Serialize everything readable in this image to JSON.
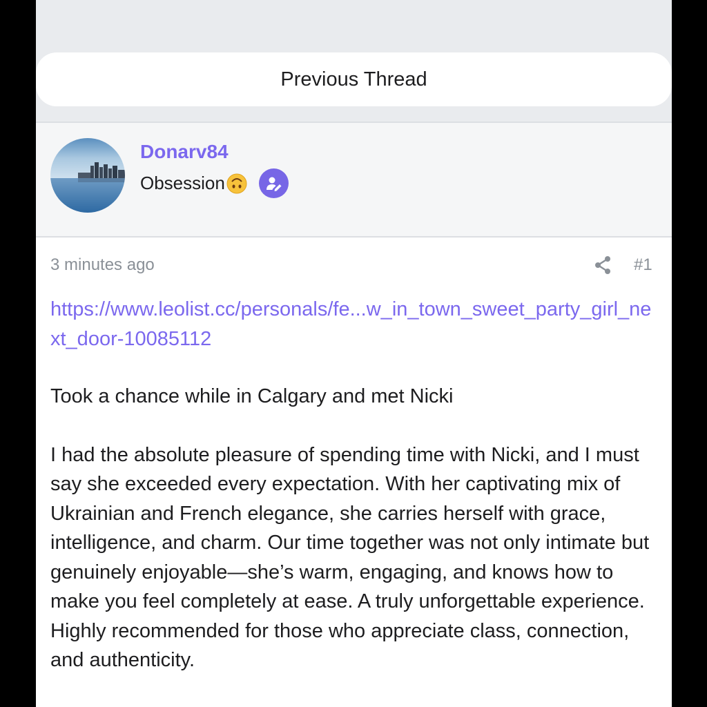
{
  "nav": {
    "previous_thread_label": "Previous Thread"
  },
  "author": {
    "username": "Donarv84",
    "title": "Obsession",
    "title_emoji_icon": "upside-down-face-emoji",
    "badge_icon": "user-edit-icon"
  },
  "post": {
    "timestamp": "3 minutes ago",
    "share_icon": "share-icon",
    "number": "#1",
    "link": "https://www.leolist.cc/personals/fe...w_in_town_sweet_party_girl_next_door-10085112",
    "paragraphs": [
      "Took a chance while in Calgary and met Nicki",
      "I had the absolute pleasure of spending time with Nicki, and I must say she exceeded every expectation. With her captivating mix of Ukrainian and French elegance, she carries herself with grace, intelligence, and charm. Our time together was not only intimate but genuinely enjoyable—she’s warm, engaging, and knows how to make you feel completely at ease. A truly unforgettable experience. Highly recommended for those who appreciate class, connection, and authenticity."
    ]
  },
  "colors": {
    "accent": "#7b68ee",
    "background_band": "#e9ebee",
    "author_band": "#f5f6f7",
    "muted_text": "#8a9097",
    "body_text": "#1d1d1f"
  }
}
